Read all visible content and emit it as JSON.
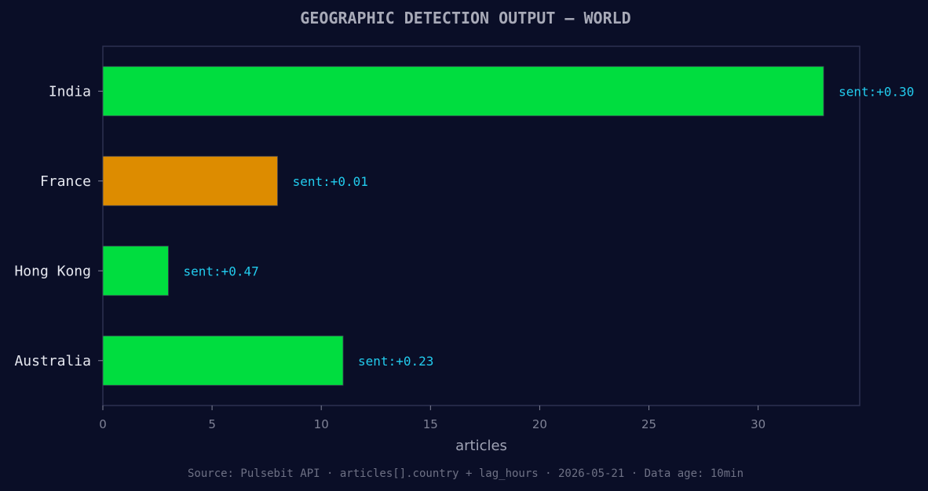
{
  "chart_data": {
    "type": "bar",
    "orientation": "horizontal",
    "title": "GEOGRAPHIC DETECTION OUTPUT — WORLD",
    "xlabel": "articles",
    "ylabel": "",
    "categories": [
      "India",
      "France",
      "Hong Kong",
      "Australia"
    ],
    "values": [
      33,
      8,
      3,
      11
    ],
    "data_labels": [
      "sent:+0.30",
      "sent:+0.01",
      "sent:+0.47",
      "sent:+0.23"
    ],
    "bar_colors": [
      "#00dd3f",
      "#dd8c00",
      "#00dd3f",
      "#00dd3f"
    ],
    "xlim": [
      0,
      34.65
    ],
    "xticks": [
      0,
      5,
      10,
      15,
      20,
      25,
      30
    ],
    "grid": false,
    "legend": "none"
  },
  "footer": "Source: Pulsebit API · articles[].country + lag_hours · 2026-05-21 · Data age: 10min",
  "colors": {
    "background": "#0a0e27",
    "frame": "#2c3150",
    "label_accent": "#22ccee"
  }
}
